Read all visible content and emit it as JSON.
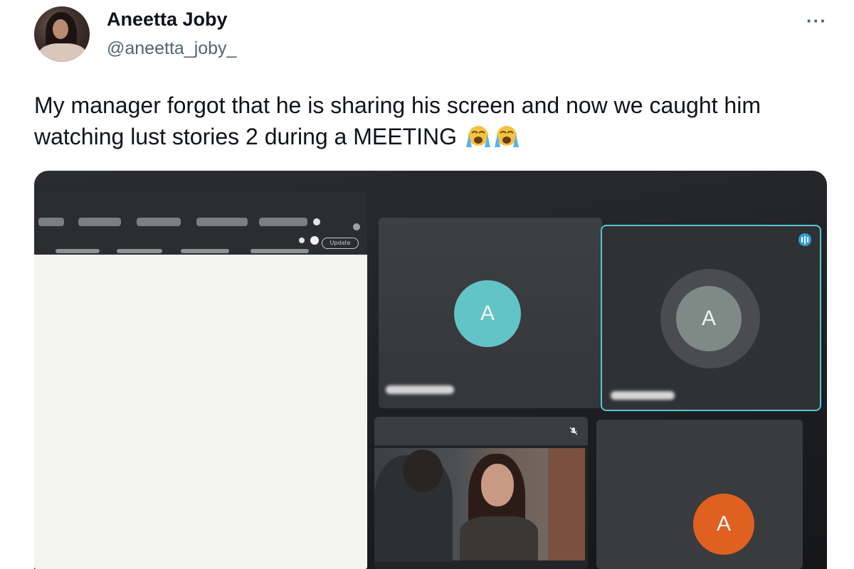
{
  "tweet": {
    "author_name": "Aneetta Joby",
    "author_handle": "@aneetta_joby_",
    "more_label": "···",
    "text": "My manager forgot that he is sharing his screen and now we caught him watching lust stories 2 during a MEETING",
    "emoji": [
      "loudly-crying-face",
      "loudly-crying-face"
    ]
  },
  "media": {
    "browser": {
      "update_label": "Update"
    },
    "participants": [
      {
        "initial": "A",
        "color": "#63c4c7"
      },
      {
        "initial": "A",
        "color": "#7f8a87",
        "speaking": true,
        "highlight_color": "#56c8d6"
      },
      {
        "initial": "",
        "type": "video"
      },
      {
        "initial": "A",
        "color": "#e06022"
      }
    ]
  }
}
